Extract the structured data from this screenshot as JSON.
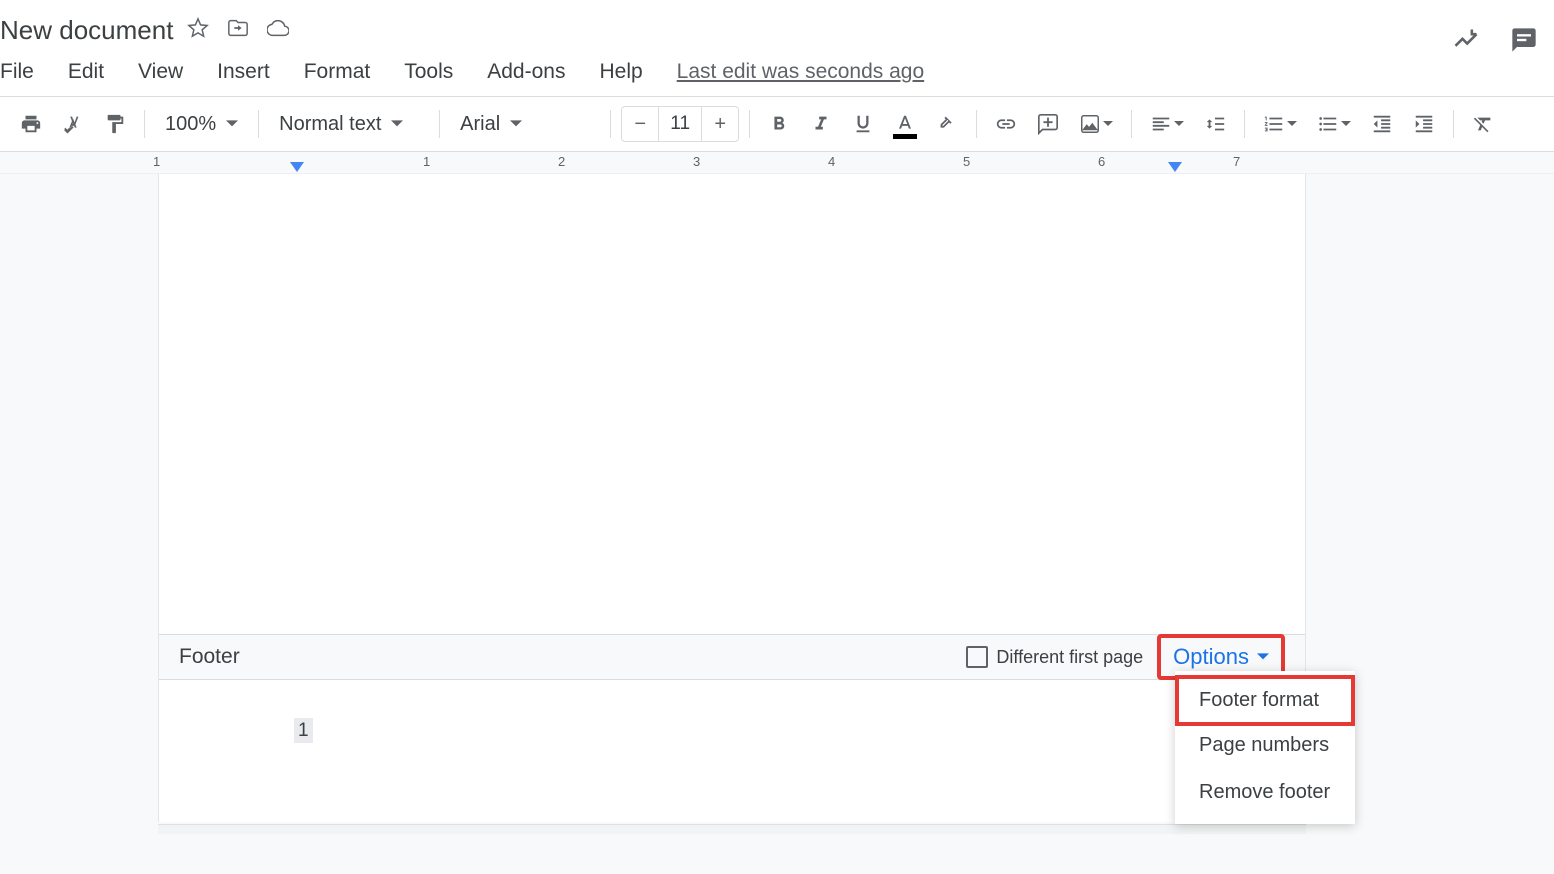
{
  "document": {
    "title": "New document",
    "last_edit": "Last edit was seconds ago"
  },
  "menubar": {
    "file": "File",
    "edit": "Edit",
    "view": "View",
    "insert": "Insert",
    "format": "Format",
    "tools": "Tools",
    "addons": "Add-ons",
    "help": "Help"
  },
  "toolbar": {
    "zoom": "100%",
    "style": "Normal text",
    "font": "Arial",
    "font_size": "11"
  },
  "ruler": {
    "numbers": [
      "1",
      "1",
      "2",
      "3",
      "4",
      "5",
      "6",
      "7"
    ]
  },
  "footer": {
    "label": "Footer",
    "checkbox_label": "Different first page",
    "options_label": "Options",
    "page_number": "1"
  },
  "options_menu": {
    "footer_format": "Footer format",
    "page_numbers": "Page numbers",
    "remove_footer": "Remove footer"
  }
}
